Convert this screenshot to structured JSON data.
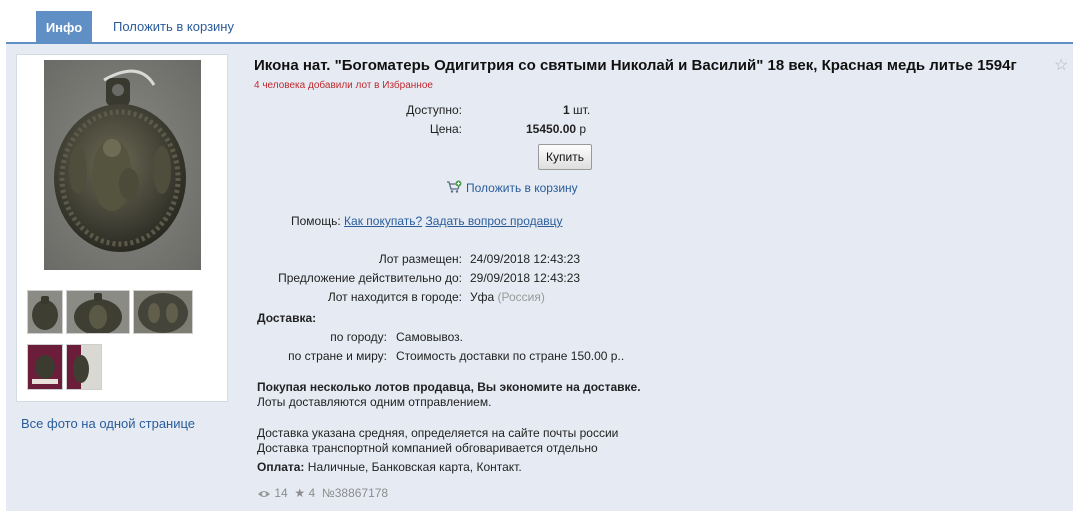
{
  "tabs": {
    "info": "Инфо",
    "add_to_cart": "Положить в корзину"
  },
  "gallery": {
    "all_photos": "Все фото на одной странице"
  },
  "lot": {
    "title": "Икона нат. \"Богоматерь Одигитрия со святыми Николай и Василий\" 18 век, Красная медь литье 1594г",
    "favorites_note": "4 человека добавили лот в Избранное",
    "available_label": "Доступно:",
    "available_value": "1",
    "available_unit": "шт.",
    "price_label": "Цена:",
    "price_value": "15450.00",
    "price_currency": "р",
    "buy_button": "Купить",
    "add_to_cart": "Положить в корзину",
    "help_label": "Помощь:",
    "help_how_to_buy": "Как покупать?",
    "help_ask_seller": "Задать вопрос продавцу",
    "placed_label": "Лот размещен:",
    "placed_value": "24/09/2018 12:43:23",
    "valid_until_label": "Предложение действительно до:",
    "valid_until_value": "29/09/2018 12:43:23",
    "city_label": "Лот находится в городе:",
    "city_value": "Уфа",
    "city_country": "(Россия)"
  },
  "delivery": {
    "heading": "Доставка:",
    "city_label": "по городу:",
    "city_value": "Самовывоз.",
    "country_label": "по стране и миру:",
    "country_value": "Стоимость доставки по стране 150.00 р..",
    "promo_bold": "Покупая несколько лотов продавца, Вы экономите на доставке.",
    "promo_note": "Лоты доставляются одним отправлением.",
    "note_1": "Доставка указана средняя, определяется на сайте почты россии",
    "note_2": "Доставка транспортной компанией обговаривается отдельно",
    "payment_label": "Оплата:",
    "payment_value": "Наличные, Банковская карта, Контакт."
  },
  "stats": {
    "views": "14",
    "favorites": "4",
    "lot_number": "№38867178"
  },
  "icons": {
    "views": "eye-icon",
    "favorites": "star-icon",
    "cart": "cart-add-icon",
    "favorite_toggle": "star-outline-icon"
  },
  "colors": {
    "accent": "#5f8fc4",
    "link": "#2a5c9a",
    "background": "#e6ebf3",
    "alert": "#c0292e"
  }
}
